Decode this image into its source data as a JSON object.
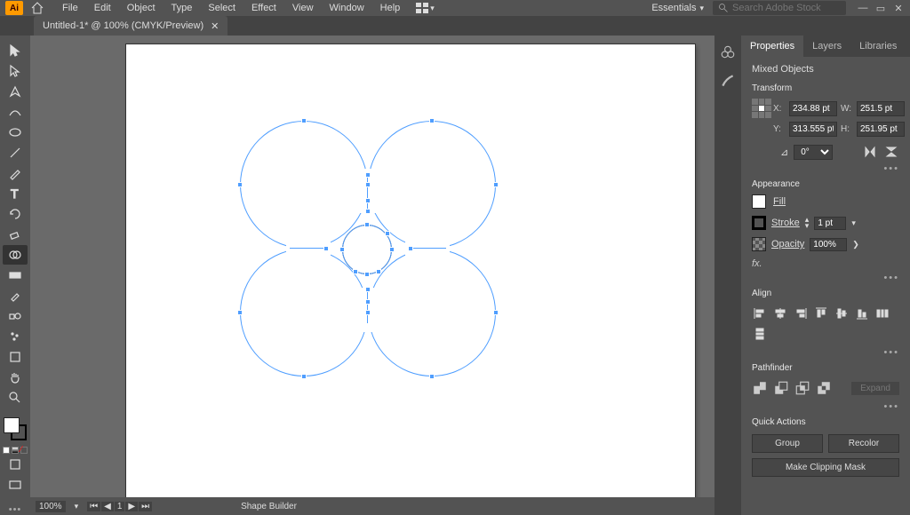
{
  "menubar": {
    "items": [
      "File",
      "Edit",
      "Object",
      "Type",
      "Select",
      "Effect",
      "View",
      "Window",
      "Help"
    ],
    "workspace": "Essentials",
    "search_placeholder": "Search Adobe Stock"
  },
  "tab": {
    "title": "Untitled-1* @ 100% (CMYK/Preview)"
  },
  "status": {
    "zoom": "100%",
    "page": "1",
    "tool": "Shape Builder"
  },
  "props": {
    "tabs": [
      "Properties",
      "Layers",
      "Libraries"
    ],
    "selection_label": "Mixed Objects",
    "transform": {
      "title": "Transform",
      "x": "234.88 pt",
      "y": "313.555 pt",
      "w": "251.5 pt",
      "h": "251.95 pt",
      "angle": "0°"
    },
    "appearance": {
      "title": "Appearance",
      "fill_label": "Fill",
      "stroke_label": "Stroke",
      "stroke_weight": "1 pt",
      "opacity_label": "Opacity",
      "opacity_value": "100%",
      "fx_label": "fx."
    },
    "align": {
      "title": "Align"
    },
    "pathfinder": {
      "title": "Pathfinder",
      "expand": "Expand"
    },
    "quick": {
      "title": "Quick Actions",
      "group": "Group",
      "recolor": "Recolor",
      "clip": "Make Clipping Mask"
    }
  }
}
